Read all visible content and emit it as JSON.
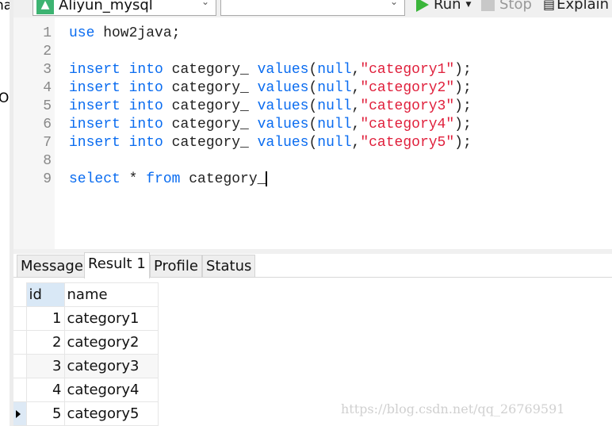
{
  "left_panel": {
    "text_top": "na",
    "text_mid": "O"
  },
  "toolbar": {
    "connection": "Aliyun_mysql",
    "database": "",
    "run_label": "Run",
    "run_menu_icon": "caret-down-icon",
    "stop_label": "Stop",
    "explain_label": "Explain"
  },
  "editor": {
    "lines": [
      {
        "n": "1",
        "tokens": [
          {
            "t": "use",
            "c": "kw"
          },
          {
            "t": " how2java;",
            "c": "plain"
          }
        ]
      },
      {
        "n": "2",
        "tokens": []
      },
      {
        "n": "3",
        "tokens": [
          {
            "t": "insert",
            "c": "kw"
          },
          {
            "t": " ",
            "c": "plain"
          },
          {
            "t": "into",
            "c": "kw"
          },
          {
            "t": " category_ ",
            "c": "plain"
          },
          {
            "t": "values",
            "c": "kw"
          },
          {
            "t": "(",
            "c": "plain"
          },
          {
            "t": "null",
            "c": "kw"
          },
          {
            "t": ",",
            "c": "plain"
          },
          {
            "t": "\"category1\"",
            "c": "str"
          },
          {
            "t": ");",
            "c": "plain"
          }
        ]
      },
      {
        "n": "4",
        "tokens": [
          {
            "t": "insert",
            "c": "kw"
          },
          {
            "t": " ",
            "c": "plain"
          },
          {
            "t": "into",
            "c": "kw"
          },
          {
            "t": " category_ ",
            "c": "plain"
          },
          {
            "t": "values",
            "c": "kw"
          },
          {
            "t": "(",
            "c": "plain"
          },
          {
            "t": "null",
            "c": "kw"
          },
          {
            "t": ",",
            "c": "plain"
          },
          {
            "t": "\"category2\"",
            "c": "str"
          },
          {
            "t": ");",
            "c": "plain"
          }
        ]
      },
      {
        "n": "5",
        "tokens": [
          {
            "t": "insert",
            "c": "kw"
          },
          {
            "t": " ",
            "c": "plain"
          },
          {
            "t": "into",
            "c": "kw"
          },
          {
            "t": " category_ ",
            "c": "plain"
          },
          {
            "t": "values",
            "c": "kw"
          },
          {
            "t": "(",
            "c": "plain"
          },
          {
            "t": "null",
            "c": "kw"
          },
          {
            "t": ",",
            "c": "plain"
          },
          {
            "t": "\"category3\"",
            "c": "str"
          },
          {
            "t": ");",
            "c": "plain"
          }
        ]
      },
      {
        "n": "6",
        "tokens": [
          {
            "t": "insert",
            "c": "kw"
          },
          {
            "t": " ",
            "c": "plain"
          },
          {
            "t": "into",
            "c": "kw"
          },
          {
            "t": " category_ ",
            "c": "plain"
          },
          {
            "t": "values",
            "c": "kw"
          },
          {
            "t": "(",
            "c": "plain"
          },
          {
            "t": "null",
            "c": "kw"
          },
          {
            "t": ",",
            "c": "plain"
          },
          {
            "t": "\"category4\"",
            "c": "str"
          },
          {
            "t": ");",
            "c": "plain"
          }
        ]
      },
      {
        "n": "7",
        "tokens": [
          {
            "t": "insert",
            "c": "kw"
          },
          {
            "t": " ",
            "c": "plain"
          },
          {
            "t": "into",
            "c": "kw"
          },
          {
            "t": " category_ ",
            "c": "plain"
          },
          {
            "t": "values",
            "c": "kw"
          },
          {
            "t": "(",
            "c": "plain"
          },
          {
            "t": "null",
            "c": "kw"
          },
          {
            "t": ",",
            "c": "plain"
          },
          {
            "t": "\"category5\"",
            "c": "str"
          },
          {
            "t": ");",
            "c": "plain"
          }
        ]
      },
      {
        "n": "8",
        "tokens": []
      },
      {
        "n": "9",
        "tokens": [
          {
            "t": "select",
            "c": "kw"
          },
          {
            "t": " * ",
            "c": "plain"
          },
          {
            "t": "from",
            "c": "kw"
          },
          {
            "t": " category_",
            "c": "plain"
          }
        ]
      }
    ]
  },
  "result_tabs": [
    {
      "label": "Message",
      "active": false
    },
    {
      "label": "Result 1",
      "active": true
    },
    {
      "label": "Profile",
      "active": false
    },
    {
      "label": "Status",
      "active": false
    }
  ],
  "result": {
    "columns": [
      "id",
      "name"
    ],
    "rows": [
      [
        "1",
        "category1"
      ],
      [
        "2",
        "category2"
      ],
      [
        "3",
        "category3"
      ],
      [
        "4",
        "category4"
      ],
      [
        "5",
        "category5"
      ]
    ],
    "current_row": 5
  },
  "watermark": "https://blog.csdn.net/qq_26769591",
  "colors": {
    "keyword": "#0a6cf0",
    "string": "#e0203c",
    "run": "#3ab53a"
  }
}
